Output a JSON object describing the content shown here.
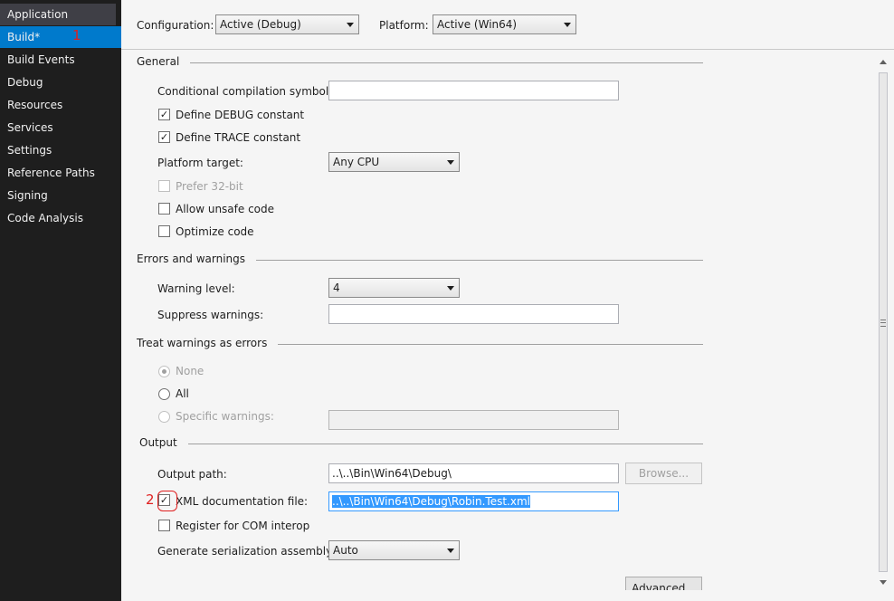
{
  "sidebar": {
    "items": [
      {
        "label": "Application"
      },
      {
        "label": "Build*"
      },
      {
        "label": "Build Events"
      },
      {
        "label": "Debug"
      },
      {
        "label": "Resources"
      },
      {
        "label": "Services"
      },
      {
        "label": "Settings"
      },
      {
        "label": "Reference Paths"
      },
      {
        "label": "Signing"
      },
      {
        "label": "Code Analysis"
      }
    ],
    "active_index": 1
  },
  "annotations": {
    "one": "1",
    "two": "2"
  },
  "toolbar": {
    "configuration_label": "Configuration:",
    "configuration_value": "Active (Debug)",
    "platform_label": "Platform:",
    "platform_value": "Active (Win64)"
  },
  "general": {
    "title": "General",
    "conditional_symbols_label": "Conditional compilation symbols:",
    "conditional_symbols_value": "",
    "define_debug_label": "Define DEBUG constant",
    "define_debug_checked": true,
    "define_trace_label": "Define TRACE constant",
    "define_trace_checked": true,
    "platform_target_label": "Platform target:",
    "platform_target_value": "Any CPU",
    "prefer32_label": "Prefer 32-bit",
    "prefer32_checked": false,
    "unsafe_label": "Allow unsafe code",
    "unsafe_checked": false,
    "optimize_label": "Optimize code",
    "optimize_checked": false
  },
  "errors": {
    "title": "Errors and warnings",
    "warning_level_label": "Warning level:",
    "warning_level_value": "4",
    "suppress_label": "Suppress warnings:",
    "suppress_value": ""
  },
  "treat": {
    "title": "Treat warnings as errors",
    "none_label": "None",
    "all_label": "All",
    "specific_label": "Specific warnings:",
    "specific_value": "",
    "selected": "None"
  },
  "output": {
    "title": "Output",
    "path_label": "Output path:",
    "path_value": "..\\..\\Bin\\Win64\\Debug\\",
    "browse_label": "Browse...",
    "xml_label": "XML documentation file:",
    "xml_checked": true,
    "xml_value": "..\\..\\Bin\\Win64\\Debug\\Robin.Test.xml",
    "com_label": "Register for COM interop",
    "com_checked": false,
    "serialization_label": "Generate serialization assembly:",
    "serialization_value": "Auto",
    "advanced_label": "Advanced..."
  },
  "icons": {
    "check": "✓"
  }
}
